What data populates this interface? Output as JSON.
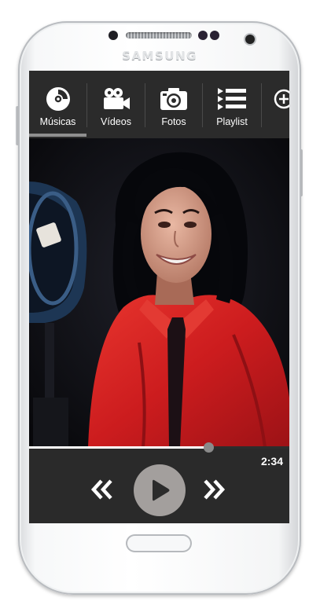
{
  "device": {
    "brand": "SAMSUNG"
  },
  "tabs": [
    {
      "label": "Músicas",
      "icon": "disc-icon",
      "active": true
    },
    {
      "label": "Vídeos",
      "icon": "video-camera-icon",
      "active": false
    },
    {
      "label": "Fotos",
      "icon": "camera-icon",
      "active": false
    },
    {
      "label": "Playlist",
      "icon": "playlist-icon",
      "active": false
    },
    {
      "label": "",
      "icon": "add-circle-icon",
      "active": false
    }
  ],
  "player": {
    "elapsed": "2:34",
    "progress_fraction": 0.69,
    "controls": [
      "rewind-icon",
      "play-icon",
      "fast-forward-icon"
    ]
  },
  "colors": {
    "bar_background": "#2b2b2b",
    "active_indicator": "#8f8f8f",
    "play_button": "#a39f9d",
    "shirt_red": "#d21d1f"
  }
}
